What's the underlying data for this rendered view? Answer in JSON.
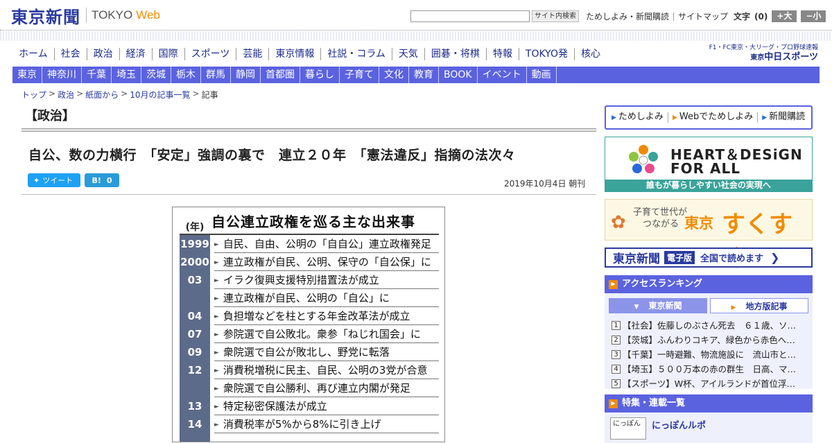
{
  "header": {
    "logo_jp": "東京新聞",
    "logo_en": "TOKYO",
    "logo_web": "Web",
    "search_button": "サイト内検索",
    "links": [
      "ためしよみ・新聞購読",
      "サイトマップ"
    ],
    "text_size_label": "文字",
    "text_size_count": "(0)",
    "enlarge_label": "+大",
    "shrink_label": "−小"
  },
  "main_nav": [
    "ホーム",
    "社会",
    "政治",
    "経済",
    "国際",
    "スポーツ",
    "芸能",
    "東京情報",
    "社説・コラム",
    "天気",
    "囲碁・将棋",
    "特報",
    "TOKYO発",
    "核心"
  ],
  "chunichi": {
    "sub": "F1・FC東京・大リーグ・プロ野球速報",
    "main_small": "東京",
    "main": "中日スポーツ"
  },
  "sub_nav": [
    "東京",
    "神奈川",
    "千葉",
    "埼玉",
    "茨城",
    "栃木",
    "群馬",
    "静岡",
    "首都圏",
    "暮らし",
    "子育て",
    "文化",
    "教育",
    "BOOK",
    "イベント",
    "動画"
  ],
  "breadcrumb": [
    "トップ",
    "政治",
    "紙面から",
    "10月の記事一覧"
  ],
  "breadcrumb_sep": ">",
  "breadcrumb_current": "記事",
  "article": {
    "section": "【政治】",
    "headline": "自公、数の力横行　「安定」強調の裏で　連立２０年　「憲法違反」指摘の法次々",
    "tweet_label": "ツイート",
    "hatena_label": "B!",
    "hatena_count": "0",
    "date": "2019年10月4日 朝刊"
  },
  "graphic": {
    "year_header": "(年)",
    "title": "自公連立政権を巡る主な出来事",
    "events": [
      {
        "year": "1999",
        "text": "自民、自由、公明の「自自公」連立政権発足"
      },
      {
        "year": "2000",
        "text": "連立政権が自民、公明、保守の「自公保」に"
      },
      {
        "year": "03",
        "text": "イラク復興支援特別措置法が成立"
      },
      {
        "year": "",
        "text": "連立政権が自民、公明の「自公」に"
      },
      {
        "year": "04",
        "text": "負担増などを柱とする年金改革法が成立"
      },
      {
        "year": "07",
        "text": "参院選で自公敗北。衆参「ねじれ国会」に"
      },
      {
        "year": "09",
        "text": "衆院選で自公が敗北し、野党に転落"
      },
      {
        "year": "12",
        "text": "消費税増税に民主、自民、公明の3党が合意"
      },
      {
        "year": "",
        "text": "衆院選で自公勝利、再び連立内閣が発足"
      },
      {
        "year": "13",
        "text": "特定秘密保護法が成立"
      },
      {
        "year": "14",
        "text": "消費税率が5%から8%に引き上げ"
      }
    ]
  },
  "sidebar": {
    "links": [
      "ためしよみ",
      "Webでためしよみ",
      "新聞購読"
    ],
    "heart_design_line1": "HEART＆DESiGN",
    "heart_design_line2": "FOR ALL",
    "heart_design_caption": "誰もが暮らしやすい社会の実現へ",
    "sukusuku_line1": "子育て世代が",
    "sukusuku_line2": "つながる",
    "sukusuku_tokyo": "東京",
    "sukusuku_main": "すくすく",
    "denshi_logo": "東京新聞",
    "denshi_badge": "電子版",
    "denshi_text": "全国で読めます",
    "ranking_title": "アクセスランキング",
    "ranking_tabs": [
      "東京新聞",
      "地方版記事"
    ],
    "ranking_items": [
      "【社会】佐藤しのぶさん死去　６１歳、ソ…",
      "【茨城】ふんわりコキア、緑色から赤色へ…",
      "【千葉】一時避難、物流施設に　流山市と…",
      "【埼玉】５００万本の赤の群生　日高、マ…",
      "【スポーツ】W杯、アイルランドが首位浮…"
    ],
    "feature_title": "特集・連載一覧",
    "feature_thumb": "にっぽん",
    "feature_link": "にっぽんルポ"
  },
  "colors": {
    "brand_blue": "#2a3aa0",
    "nav_purple": "#5b62e0",
    "accent_orange": "#f08c00",
    "teal": "#3aa39a"
  }
}
